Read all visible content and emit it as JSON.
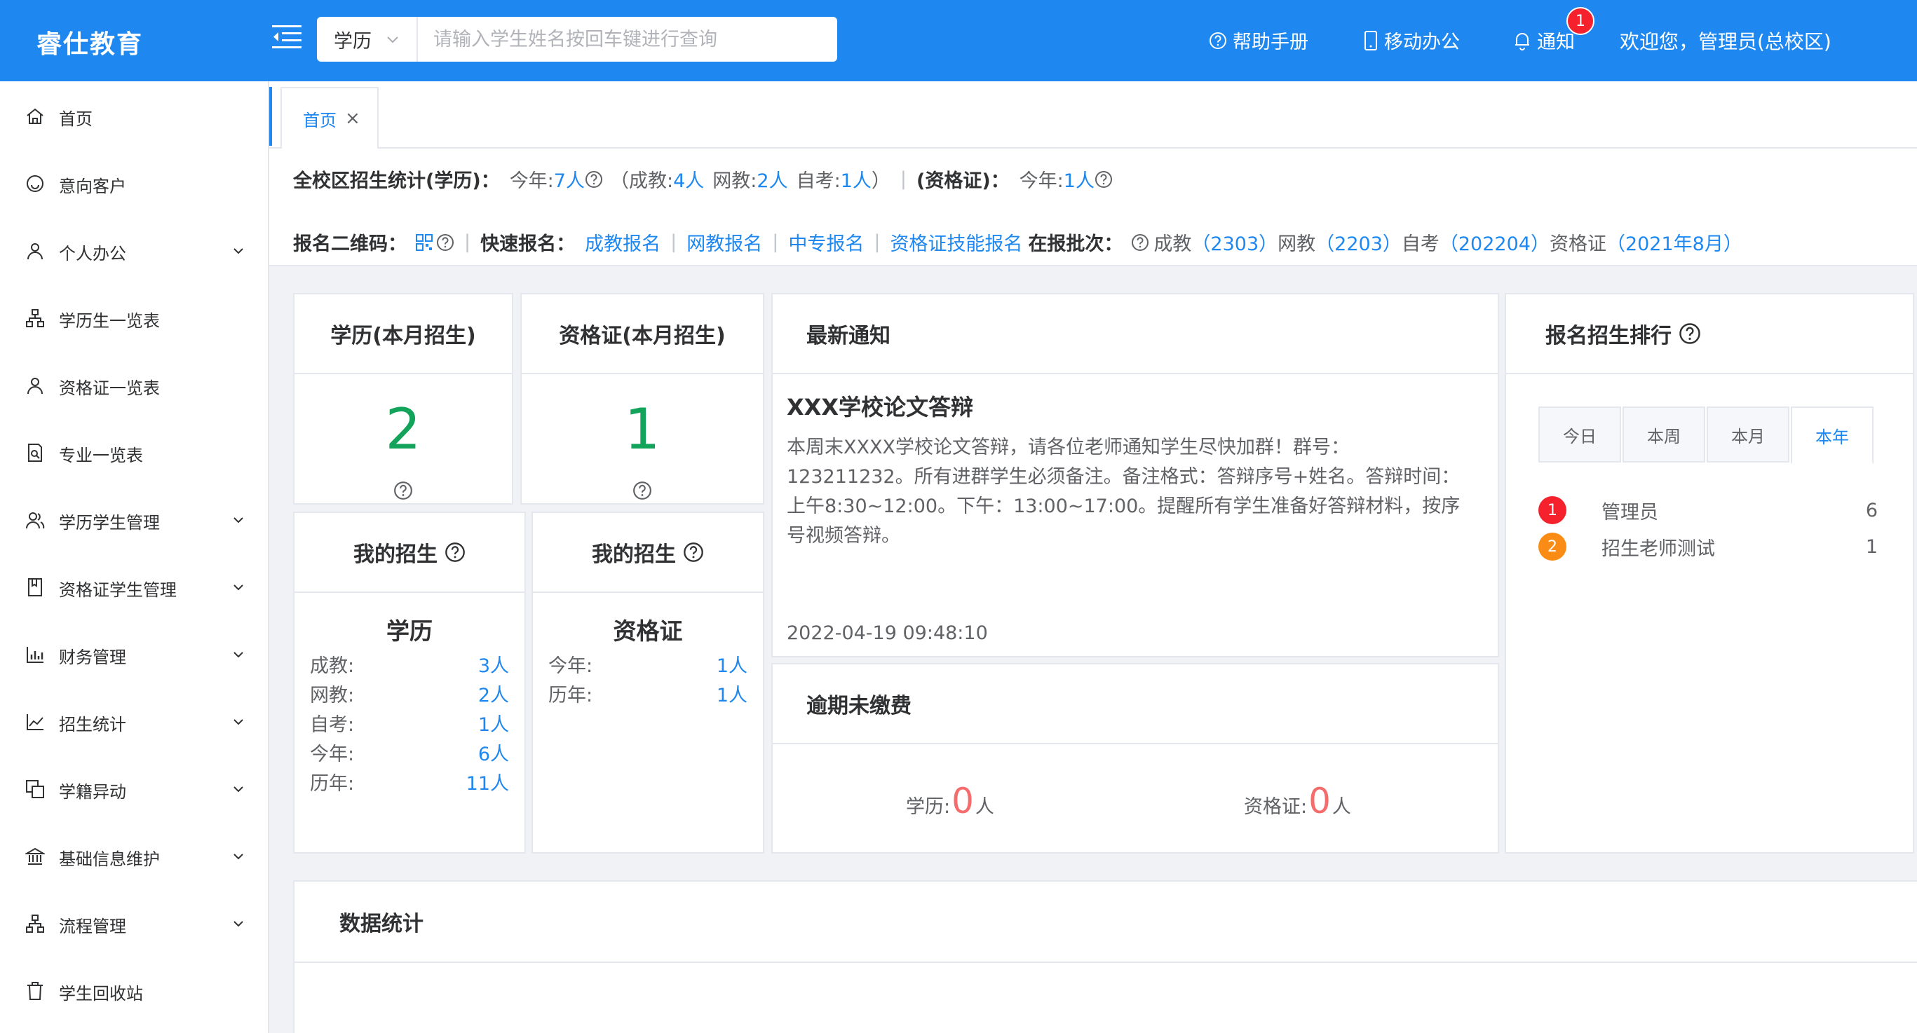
{
  "header": {
    "logo": "睿仕教育",
    "search_select": "学历",
    "search_placeholder": "请输入学生姓名按回车键进行查询",
    "help": "帮助手册",
    "mobile": "移动办公",
    "notify": "通知",
    "notify_count": "1",
    "welcome": "欢迎您，管理员(总校区)",
    "accent_color": "#1e88f0"
  },
  "sidebar": {
    "items": [
      {
        "label": "首页",
        "icon": "home-icon",
        "has_arrow": false
      },
      {
        "label": "意向客户",
        "icon": "smile-icon",
        "has_arrow": false
      },
      {
        "label": "个人办公",
        "icon": "user-icon",
        "has_arrow": true
      },
      {
        "label": "学历生一览表",
        "icon": "sitemap-icon",
        "has_arrow": false
      },
      {
        "label": "资格证一览表",
        "icon": "user-icon",
        "has_arrow": false
      },
      {
        "label": "专业一览表",
        "icon": "document-search-icon",
        "has_arrow": false
      },
      {
        "label": "学历学生管理",
        "icon": "user-group-icon",
        "has_arrow": true
      },
      {
        "label": "资格证学生管理",
        "icon": "notebook-icon",
        "has_arrow": true
      },
      {
        "label": "财务管理",
        "icon": "bar-chart-icon",
        "has_arrow": true
      },
      {
        "label": "招生统计",
        "icon": "line-chart-icon",
        "has_arrow": true
      },
      {
        "label": "学籍异动",
        "icon": "copy-icon",
        "has_arrow": true
      },
      {
        "label": "基础信息维护",
        "icon": "bank-icon",
        "has_arrow": true
      },
      {
        "label": "流程管理",
        "icon": "sitemap-icon",
        "has_arrow": true
      },
      {
        "label": "学生回收站",
        "icon": "trash-icon",
        "has_arrow": false
      }
    ]
  },
  "tabs": {
    "home": "首页"
  },
  "stats": {
    "all_label": "全校区招生统计(学历)：",
    "this_year_label": "今年:",
    "this_year_value": "7人",
    "adult_label": "（成教:",
    "adult_value": "4人",
    "online_label": "网教:",
    "online_value": "2人",
    "self_label": "自考:",
    "self_value": "1人",
    "close_paren": "）",
    "cert_label": "(资格证)：",
    "cert_year_label": "今年:",
    "cert_year_value": "1人",
    "qr_label": "报名二维码：",
    "quick_label": "快速报名：",
    "quick_links": [
      "成教报名",
      "网教报名",
      "中专报名",
      "资格证技能报名"
    ],
    "batch_label": "在报批次：",
    "batch_adult_label": "成教",
    "batch_adult": "（2303）",
    "batch_online_label": "网教",
    "batch_online": "（2203）",
    "batch_self_label": "自考",
    "batch_self": "（202204）",
    "batch_cert_label": "资格证",
    "batch_cert": "（2021年8月）"
  },
  "cards": {
    "edu_month_title": "学历(本月招生)",
    "edu_month_value": "2",
    "cert_month_title": "资格证(本月招生)",
    "cert_month_value": "1",
    "my_edu_title": "我的招生",
    "my_edu_sub": "学历",
    "my_edu_rows": [
      {
        "k": "成教:",
        "v": "3人"
      },
      {
        "k": "网教:",
        "v": "2人"
      },
      {
        "k": "自考:",
        "v": "1人"
      },
      {
        "k": "今年:",
        "v": "6人"
      },
      {
        "k": "历年:",
        "v": "11人"
      }
    ],
    "my_cert_title": "我的招生",
    "my_cert_sub": "资格证",
    "my_cert_rows": [
      {
        "k": "今年:",
        "v": "1人"
      },
      {
        "k": "历年:",
        "v": "1人"
      }
    ]
  },
  "notice": {
    "head": "最新通知",
    "title": "XXX学校论文答辩",
    "body": "本周末XXXX学校论文答辩，请各位老师通知学生尽快加群！群号：123211232。所有进群学生必须备注。备注格式：答辩序号+姓名。答辩时间：上午8:30~12:00。下午：13:00~17:00。提醒所有学生准备好答辩材料，按序号视频答辩。",
    "time": "2022-04-19 09:48:10"
  },
  "overdue": {
    "head": "逾期未缴费",
    "edu_label": "学历:",
    "edu_value": "0",
    "cert_label": "资格证:",
    "cert_value": "0",
    "unit": "人"
  },
  "ranking": {
    "head": "报名招生排行",
    "tabs": [
      "今日",
      "本周",
      "本月",
      "本年"
    ],
    "active_tab": "本年",
    "rows": [
      {
        "rank": "1",
        "name": "管理员",
        "count": "6",
        "color": "#f5222d"
      },
      {
        "rank": "2",
        "name": "招生老师测试",
        "count": "1",
        "color": "#fa8c16"
      }
    ]
  },
  "data_stats": {
    "head": "数据统计"
  }
}
